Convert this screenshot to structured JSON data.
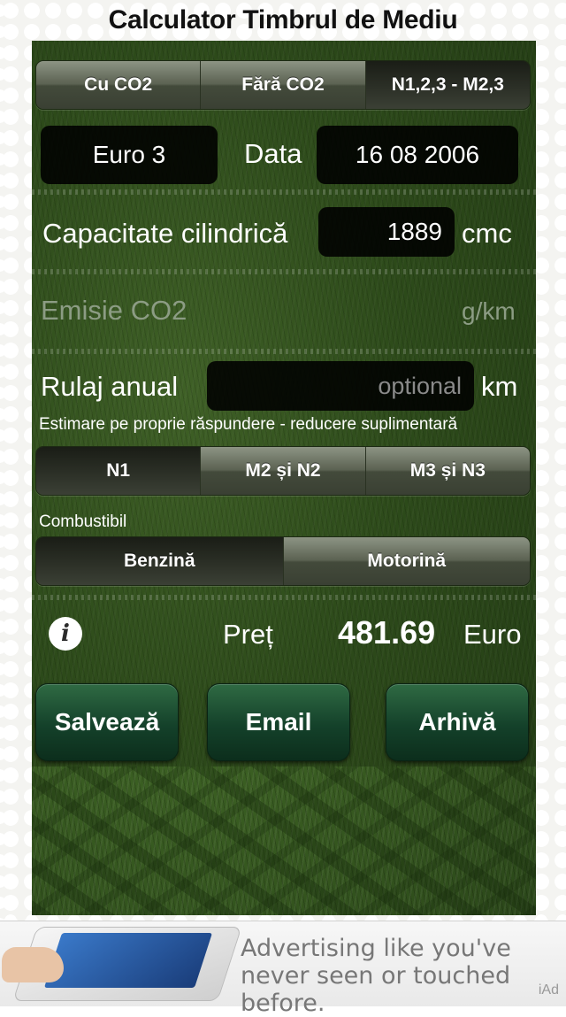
{
  "title": "Calculator Timbrul de Mediu",
  "tabs_mode": [
    "Cu CO2",
    "Fără CO2",
    "N1,2,3 - M2,3"
  ],
  "euro_norm": "Euro 3",
  "date_label": "Data",
  "date_value": "16 08 2006",
  "capacity": {
    "label": "Capacitate cilindrică",
    "value": "1889",
    "unit": "cmc"
  },
  "emission": {
    "label": "Emisie CO2",
    "unit": "g/km"
  },
  "mileage": {
    "label": "Rulaj anual",
    "placeholder": "optional",
    "unit": "km",
    "note": "Estimare pe proprie răspundere - reducere suplimentară"
  },
  "tabs_category": [
    "N1",
    "M2 și N2",
    "M3 și N3"
  ],
  "fuel": {
    "label": "Combustibil",
    "options": [
      "Benzină",
      "Motorină"
    ]
  },
  "price": {
    "label": "Preț",
    "value": "481.69",
    "currency": "Euro",
    "info_glyph": "i"
  },
  "actions": {
    "save": "Salvează",
    "email": "Email",
    "archive": "Arhivă"
  },
  "ad": {
    "text": "Advertising like you've never seen or touched before.",
    "mark": "iAd"
  },
  "colors": {
    "grass": "#3d6224",
    "button_green": "#14412a",
    "field": "#000000"
  }
}
